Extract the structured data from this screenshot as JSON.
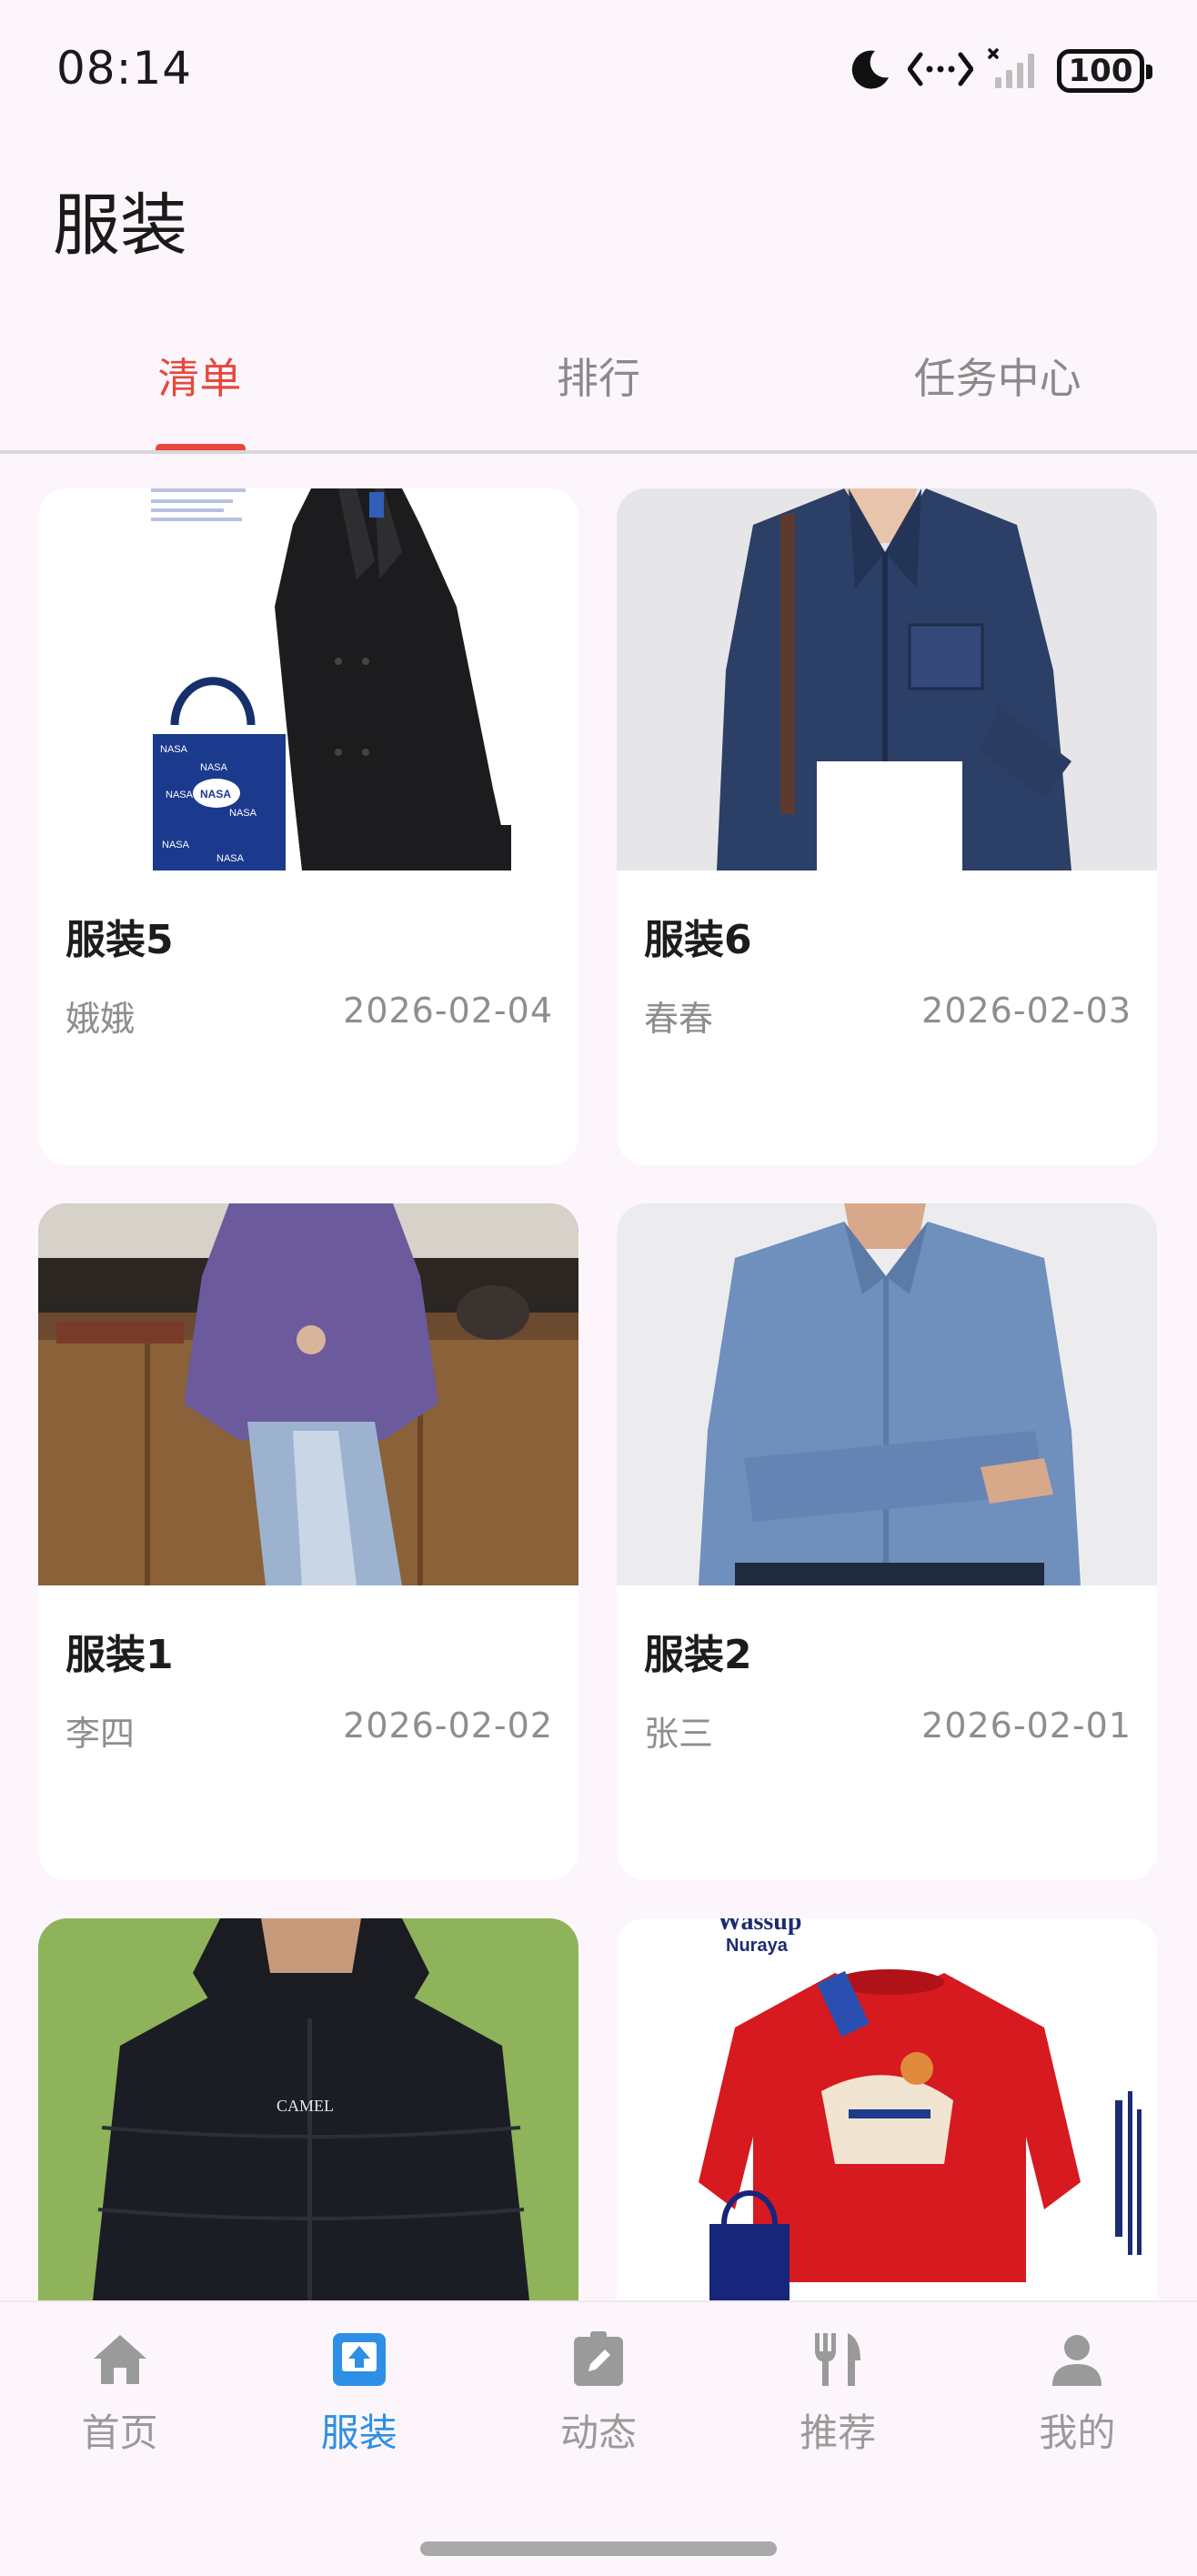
{
  "status_bar": {
    "time": "08:14",
    "battery": "100",
    "icons": [
      "moon-icon",
      "data-transfer-icon",
      "signal-off-icon",
      "battery-icon"
    ]
  },
  "header": {
    "title": "服装"
  },
  "tabs": [
    {
      "label": "清单",
      "active": true
    },
    {
      "label": "排行",
      "active": false
    },
    {
      "label": "任务中心",
      "active": false
    }
  ],
  "cards": [
    {
      "title": "服装5",
      "author": "娥娥",
      "date": "2026-02-04",
      "image": "black-trench-coat-with-nasa-tote"
    },
    {
      "title": "服装6",
      "author": "春春",
      "date": "2026-02-03",
      "image": "denim-shirt"
    },
    {
      "title": "服装1",
      "author": "李四",
      "date": "2026-02-02",
      "image": "purple-knit-outfit"
    },
    {
      "title": "服装2",
      "author": "张三",
      "date": "2026-02-01",
      "image": "blue-oxford-shirt"
    },
    {
      "title": "",
      "author": "",
      "date": "",
      "image": "black-puffer-jacket",
      "image_text": "CAMEL"
    },
    {
      "title": "",
      "author": "",
      "date": "",
      "image": "red-sweater",
      "image_text": "Wassup",
      "image_text2": "Nuraya"
    }
  ],
  "bottom_nav": [
    {
      "label": "首页",
      "icon": "home-icon",
      "active": false
    },
    {
      "label": "服装",
      "icon": "upload-icon",
      "active": true
    },
    {
      "label": "动态",
      "icon": "edit-clipboard-icon",
      "active": false
    },
    {
      "label": "推荐",
      "icon": "fork-knife-icon",
      "active": false
    },
    {
      "label": "我的",
      "icon": "person-icon",
      "active": false
    }
  ],
  "colors": {
    "accent": "#E8473C",
    "nav_active": "#2E8FE6",
    "nav_inactive": "#9a9a9a",
    "background": "#FCF6FC"
  }
}
